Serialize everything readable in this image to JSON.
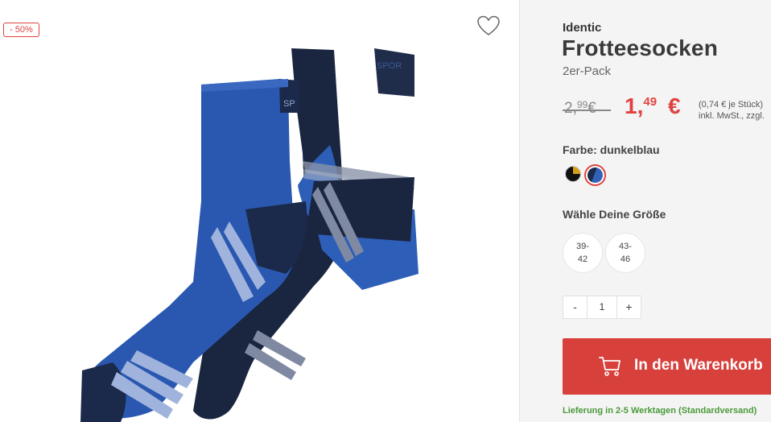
{
  "gallery": {
    "discount_badge": "- 50%",
    "wishlist_icon": "heart-outline-icon",
    "image_alt": "socks product image"
  },
  "product": {
    "brand": "Identic",
    "title": "Frotteesocken",
    "subtitle": "2er-Pack"
  },
  "price": {
    "old_main": "2,",
    "old_cents": "99",
    "old_currency": "€",
    "new_main": "1,",
    "new_cents": "49",
    "new_currency": "€",
    "unit_note": "(0,74 € je Stück)",
    "tax_note": "inkl. MwSt., zzgl."
  },
  "color": {
    "label": "Farbe: dunkelblau",
    "swatches": [
      "black-yellow",
      "dunkelblau"
    ],
    "selected": "dunkelblau"
  },
  "size": {
    "label": "Wähle Deine Größe",
    "options": [
      {
        "line1": "39-",
        "line2": "42"
      },
      {
        "line1": "43-",
        "line2": "46"
      }
    ]
  },
  "quantity": {
    "minus": "-",
    "value": "1",
    "plus": "+"
  },
  "cart": {
    "label": "In den Warenkorb",
    "icon": "shopping-cart-icon"
  },
  "delivery": {
    "text": "Lieferung in 2-5 Werktagen (Standardversand)"
  },
  "colors": {
    "accent": "#d8403c",
    "price_red": "#e0433f",
    "delivery_green": "#4a9a3a",
    "panel_bg": "#f4f4f4"
  }
}
